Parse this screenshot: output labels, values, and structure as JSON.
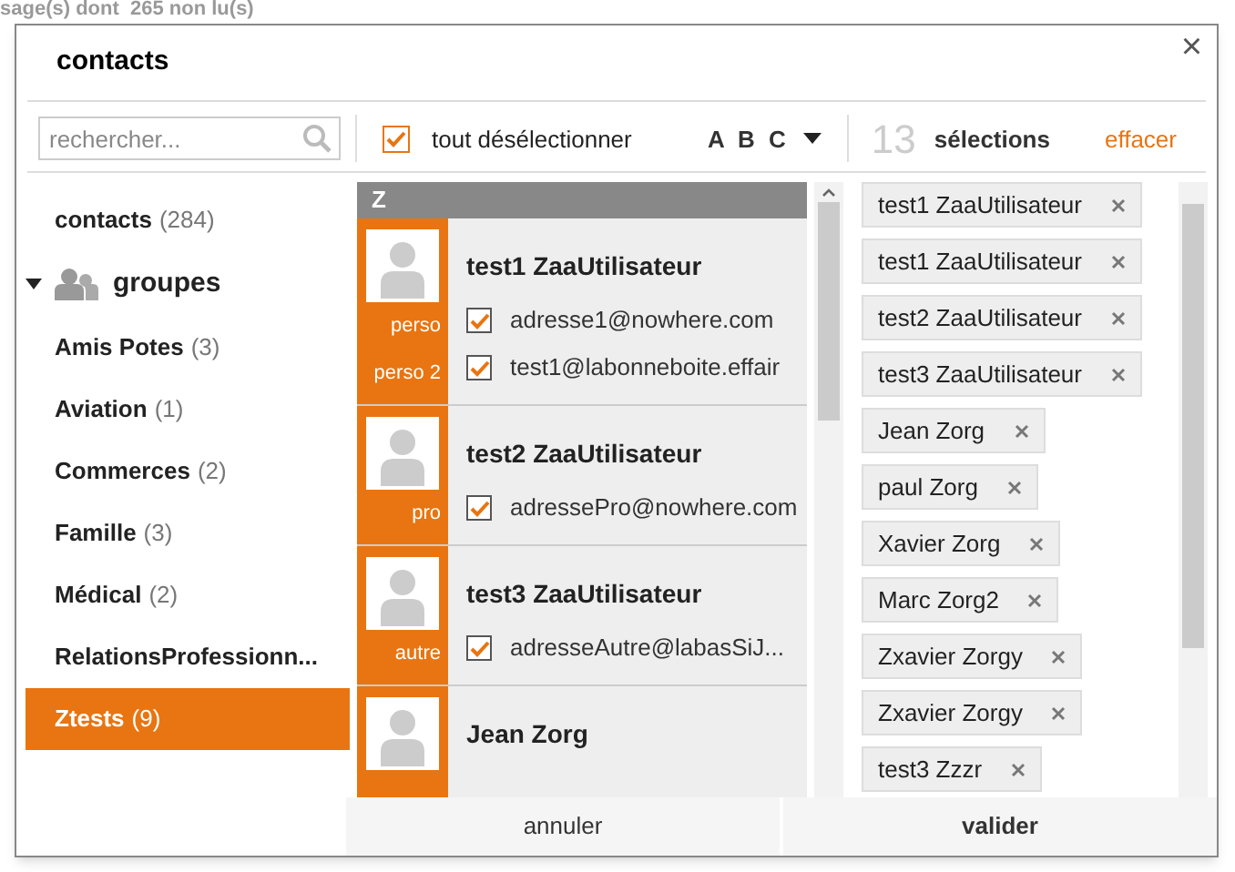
{
  "background_text": "sage(s) dont  265 non lu(s)",
  "dialog": {
    "title": "contacts",
    "close": "×"
  },
  "toolbar": {
    "search": {
      "placeholder": "rechercher..."
    },
    "select_all": {
      "label": "tout désélectionner",
      "checked": true
    },
    "sort": "A B C",
    "count": "13",
    "count_label": "sélections",
    "clear": "effacer"
  },
  "sidebar": {
    "contacts": {
      "label": "contacts",
      "count": "(284)",
      "selected": false
    },
    "groups_header": {
      "label": "groupes",
      "expanded": true
    },
    "groups": [
      {
        "label": "Amis Potes",
        "count": "(3)",
        "selected": false
      },
      {
        "label": "Aviation",
        "count": "(1)",
        "selected": false
      },
      {
        "label": "Commerces",
        "count": "(2)",
        "selected": false
      },
      {
        "label": "Famille",
        "count": "(3)",
        "selected": false
      },
      {
        "label": "Médical",
        "count": "(2)",
        "selected": false
      },
      {
        "label": "RelationsProfessionn...",
        "selected": false
      },
      {
        "label": "Ztests",
        "count": "(9)",
        "selected": true
      }
    ]
  },
  "contacts": {
    "letter": "Z",
    "items": [
      {
        "name": "test1 ZaaUtilisateur",
        "addresses": [
          {
            "type": "perso",
            "email": "adresse1@nowhere.com",
            "checked": true
          },
          {
            "type": "perso 2",
            "email": "test1@labonneboite.effair",
            "checked": true
          }
        ]
      },
      {
        "name": "test2 ZaaUtilisateur",
        "addresses": [
          {
            "type": "pro",
            "email": "adressePro@nowhere.com",
            "checked": true
          }
        ]
      },
      {
        "name": "test3 ZaaUtilisateur",
        "addresses": [
          {
            "type": "autre",
            "email": "adresseAutre@labasSiJ...",
            "checked": true
          }
        ]
      },
      {
        "name": "Jean Zorg"
      }
    ]
  },
  "selections": [
    {
      "label": "test1 ZaaUtilisateur"
    },
    {
      "label": "test1 ZaaUtilisateur"
    },
    {
      "label": "test2 ZaaUtilisateur"
    },
    {
      "label": "test3 ZaaUtilisateur"
    },
    {
      "label": "Jean Zorg"
    },
    {
      "label": "paul Zorg"
    },
    {
      "label": "Xavier Zorg"
    },
    {
      "label": "Marc Zorg2"
    },
    {
      "label": "Zxavier Zorgy"
    },
    {
      "label": "Zxavier Zorgy"
    },
    {
      "label": "test3 Zzzr"
    }
  ],
  "footer": {
    "cancel": "annuler",
    "confirm": "valider"
  }
}
